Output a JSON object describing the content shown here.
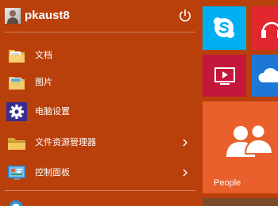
{
  "user": {
    "name": "pkaust8"
  },
  "menu": {
    "items": [
      {
        "label": "文档",
        "icon": "folder-documents-icon",
        "has_submenu": false
      },
      {
        "label": "图片",
        "icon": "folder-pictures-icon",
        "has_submenu": false
      },
      {
        "label": "电脑设置",
        "icon": "gear-icon",
        "has_submenu": false
      },
      {
        "label": "文件资源管理器",
        "icon": "file-explorer-icon",
        "has_submenu": true
      },
      {
        "label": "控制面板",
        "icon": "control-panel-icon",
        "has_submenu": true
      }
    ]
  },
  "tiles": {
    "skype": {
      "icon": "skype-icon",
      "color": "#00aff0"
    },
    "music": {
      "icon": "headphones-icon",
      "color": "#e1282e"
    },
    "video": {
      "icon": "video-icon",
      "color": "#c3173b"
    },
    "onedrive": {
      "icon": "cloud-icon",
      "color": "#1c78d4"
    },
    "people": {
      "label": "People",
      "icon": "people-icon",
      "color": "#e9602c"
    }
  },
  "colors": {
    "start_background": "#b9400b",
    "text": "#ffffff"
  }
}
